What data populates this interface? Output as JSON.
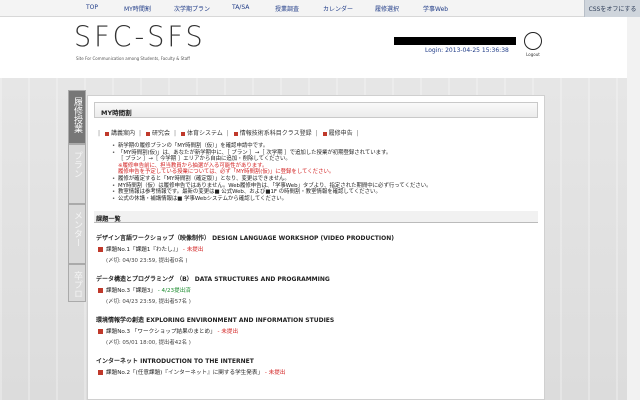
{
  "nav": {
    "items": [
      "TOP",
      "MY時間割",
      "次学期プラン",
      "TA/SA",
      "授業調査",
      "カレンダー",
      "履修選択",
      "学事Web"
    ],
    "css_toggle": "CSSをオフにする"
  },
  "header": {
    "logo": "SFC-SFS",
    "logo_sub": "Site For Communication among Students, Faculty & Staff",
    "login": "Login: 2013-04-25 15:36:38",
    "logout_label": "Logout"
  },
  "side_tabs": [
    "履修授業",
    "プラン",
    "メンター",
    "卒プロ"
  ],
  "panel": {
    "title": "MY時間割",
    "links": [
      "講義案内",
      "研究会",
      "体育システム",
      "情報技術系科目クラス登録",
      "履修申告"
    ],
    "notes": [
      "新学期の履修プランの「MY時間割（仮）」を確認申請中です。",
      "「MY時間割(仮)」は、あなたが新学期中に、［ プラン ］→［ 次学期 ］で追加した授業が初期登録されています。",
      "［ プラン ］→［ 今学期 ］エリアから自由に追加・削除してください。",
      "※履修申告前に、担当教員から抽選が入る可能性があります。",
      "履修申告を予定している授業については、必ず「MY時間割(仮)」に登録をしてください。",
      "履修が確定すると「MY時間割（確定版）」となり、変更はできません。",
      "MY時間割（仮）は履修申告ではありません。Web履修申告は、「学事Web」タブより、指定された期間中に必ず行ってください。",
      "教室情報は参考情報です。最新の変更は■ 公式Web、および■1F の時間割・教室情報を確認してください。",
      "公式の休講・補講情報は■ 学事Webシステムから確認してください。"
    ],
    "section_title": "課題一覧",
    "courses": [
      {
        "title": "デザイン言語ワークショップ（映像制作） DESIGN LANGUAGE WORKSHOP (VIDEO PRODUCTION)",
        "task": "課題No.1「課題1『わたし』」",
        "status": "- 未提出",
        "status_type": "red",
        "deadline": "(〆切: 04/30 23:59, 提出者0名 )"
      },
      {
        "title": "データ構造とプログラミング （B） DATA STRUCTURES AND PROGRAMMING",
        "task": "課題No.3「課題3」",
        "status": "- 4/23提出済",
        "status_type": "green",
        "deadline": "(〆切: 04/23 23:59, 提出者57名 )"
      },
      {
        "title": "環境情報学の創造 EXPLORING ENVIRONMENT AND INFORMATION STUDIES",
        "task": "課題No.3 「ワークショップ結果のまとめ」",
        "status": "- 未提出",
        "status_type": "red",
        "deadline": "(〆切: 05/01 18:00, 提出者42名 )"
      },
      {
        "title": "インターネット INTRODUCTION TO THE INTERNET",
        "task": "課題No.2「(任意課題)『インターネット』に関する学生発表」",
        "status": "- 未提出",
        "status_type": "red",
        "deadline": ""
      }
    ]
  },
  "colors": {
    "link_blue": "#1f3b87",
    "alert_red": "#d21f1f",
    "ok_green": "#1b8c2e",
    "tab_active": "#777777"
  }
}
